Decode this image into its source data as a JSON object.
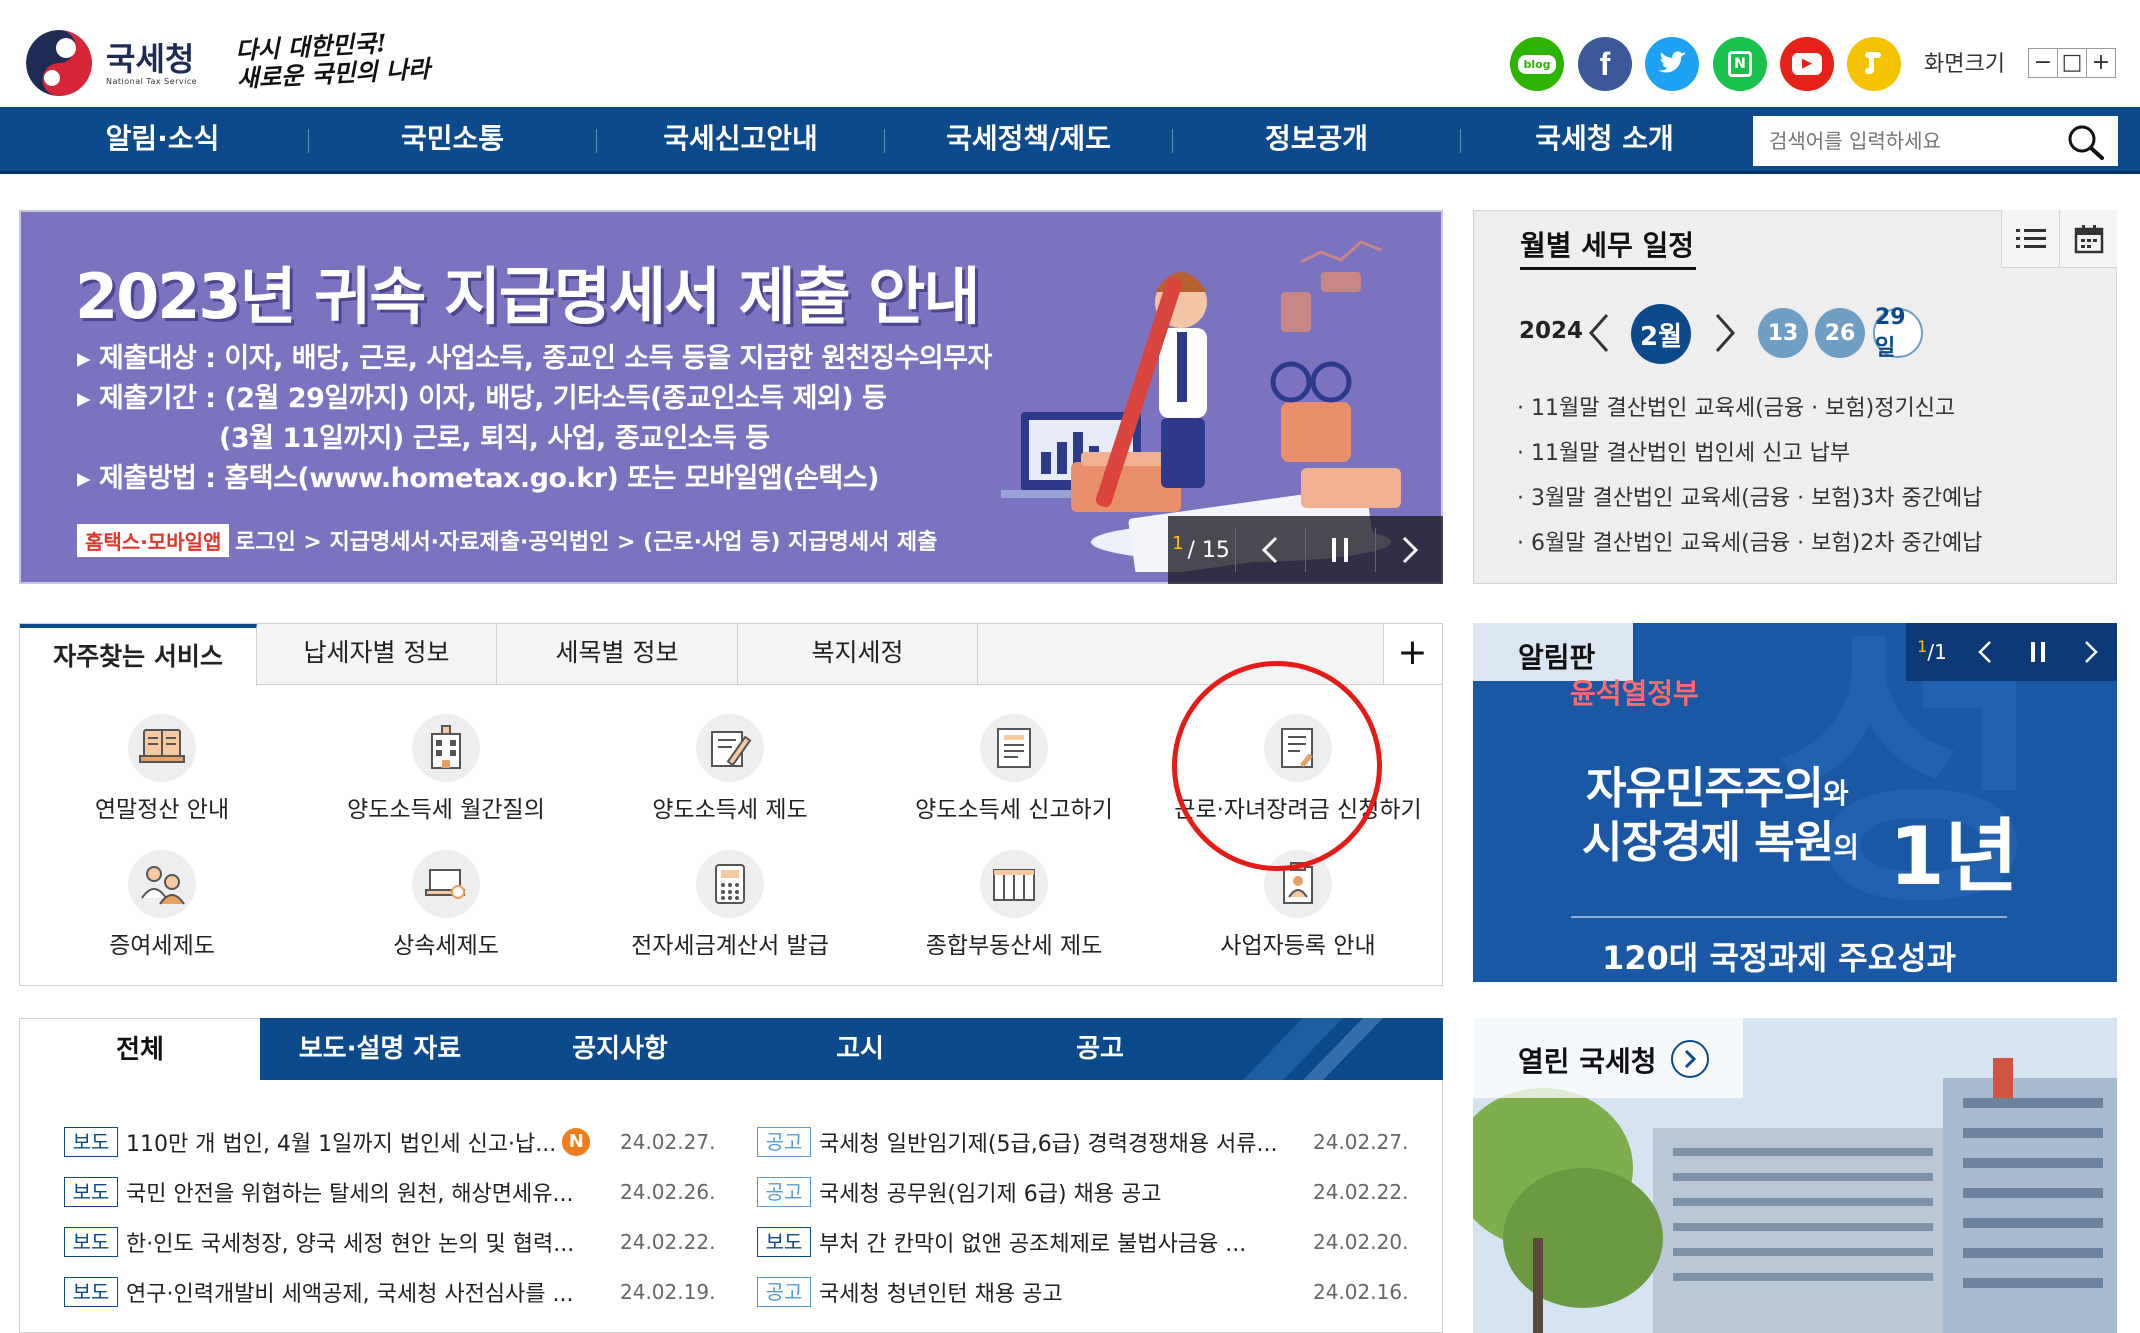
{
  "header": {
    "logo_text": "국세청",
    "logo_sub": "National Tax Service",
    "slogan_line1": "다시 대한민국!",
    "slogan_line2": "새로운 국민의 나라",
    "sns": [
      {
        "name": "blog",
        "label": "blog",
        "color": "#2db400"
      },
      {
        "name": "facebook",
        "label": "f",
        "color": "#3b5998"
      },
      {
        "name": "twitter",
        "label": "t",
        "color": "#1da1f2"
      },
      {
        "name": "naver-post",
        "label": "N",
        "color": "#19c34b"
      },
      {
        "name": "youtube",
        "label": "▶",
        "color": "#e62117"
      },
      {
        "name": "kakao-story",
        "label": "s",
        "color": "#f5c200"
      }
    ],
    "font_size_label": "화면크기",
    "font_minus": "−",
    "font_reset": "□",
    "font_plus": "+"
  },
  "gnb": {
    "items": [
      "알림·소식",
      "국민소통",
      "국세신고안내",
      "국세정책/제도",
      "정보공개",
      "국세청 소개"
    ],
    "search_placeholder": "검색어를 입력하세요"
  },
  "banner": {
    "title": "2023년 귀속 지급명세서 제출 안내",
    "lines": [
      "▸ 제출대상 : 이자, 배당, 근로, 사업소득, 종교인 소득 등을 지급한 원천징수의무자",
      "▸ 제출기간 : (2월 29일까지) 이자, 배당, 기타소득(종교인소득 제외) 등",
      "(3월 11일까지) 근로, 퇴직, 사업, 종교인소득 등",
      "▸ 제출방법 : 홈택스(www.hometax.go.kr) 또는 모바일앱(손택스)"
    ],
    "tag": "홈택스·모바일앱",
    "path": "로그인 > 지급명세서·자료제출·공익법인 > (근로·사업 등) 지급명세서 제출",
    "page_current": "1",
    "page_total": "/ 15"
  },
  "calendar": {
    "title": "월별 세무 일정",
    "year": "2024",
    "month": "2월",
    "days": [
      "13",
      "26",
      "29일"
    ],
    "items": [
      "· 11월말 결산법인 교육세(금융 · 보험)정기신고",
      "· 11월말 결산법인 법인세 신고 납부",
      "· 3월말 결산법인 교육세(금융 · 보험)3차 중간예납",
      "· 6월말 결산법인 교육세(금융 · 보험)2차 중간예납"
    ]
  },
  "services": {
    "tabs": [
      "자주찾는 서비스",
      "납세자별 정보",
      "세목별 정보",
      "복지세정"
    ],
    "plus": "+",
    "items": [
      {
        "label": "연말정산 안내",
        "icon": "book-icon"
      },
      {
        "label": "양도소득세 월간질의",
        "icon": "building-icon"
      },
      {
        "label": "양도소득세 제도",
        "icon": "document-pen-icon"
      },
      {
        "label": "양도소득세 신고하기",
        "icon": "form-icon"
      },
      {
        "label": "근로·자녀장려금 신청하기",
        "icon": "application-icon"
      },
      {
        "label": "증여세제도",
        "icon": "people-icon"
      },
      {
        "label": "상속세제도",
        "icon": "laptop-search-icon"
      },
      {
        "label": "전자세금계산서 발급",
        "icon": "calculator-icon"
      },
      {
        "label": "종합부동산세 제도",
        "icon": "building-grid-icon"
      },
      {
        "label": "사업자등록 안내",
        "icon": "clipboard-person-icon"
      }
    ]
  },
  "board": {
    "title": "알림판",
    "page_current": "1",
    "page_total": "/1",
    "sub": "윤석열정부",
    "main_line1_a": "자유민주주의",
    "main_line1_b": "와",
    "main_line2_a": "시장경제 복원",
    "main_line2_b": "의",
    "big": "1년",
    "bottom": "120대 국정과제 주요성과"
  },
  "news": {
    "tabs": [
      "전체",
      "보도·설명 자료",
      "공지사항",
      "고시",
      "공고"
    ],
    "left": [
      {
        "badge": "보도",
        "title": "110만 개 법인, 4월 1일까지 법인세 신고·납...",
        "date": "24.02.27.",
        "new": "N"
      },
      {
        "badge": "보도",
        "title": "국민 안전을 위협하는 탈세의 원천, 해상면세유...",
        "date": "24.02.26."
      },
      {
        "badge": "보도",
        "title": "한·인도 국세청장, 양국 세정 현안 논의 및 협력...",
        "date": "24.02.22."
      },
      {
        "badge": "보도",
        "title": "연구·인력개발비 세액공제, 국세청 사전심사를 ...",
        "date": "24.02.19."
      }
    ],
    "right": [
      {
        "badge": "공고",
        "title": "국세청 일반임기제(5급,6급) 경력경쟁채용 서류...",
        "date": "24.02.27."
      },
      {
        "badge": "공고",
        "title": "국세청 공무원(임기제 6급) 채용 공고",
        "date": "24.02.22."
      },
      {
        "badge": "보도",
        "title": "부처 간 칸막이 없앤 공조체제로 불법사금융 ...",
        "date": "24.02.20."
      },
      {
        "badge": "공고",
        "title": "국세청 청년인턴 채용 공고",
        "date": "24.02.16."
      }
    ]
  },
  "open_nts": {
    "title": "열린 국세청"
  }
}
